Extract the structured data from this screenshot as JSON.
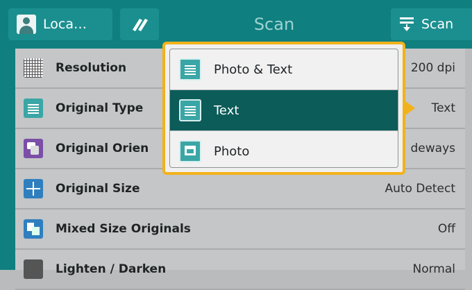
{
  "header": {
    "location_label": "Loca…",
    "title": "Scan",
    "scan_label": "Scan",
    "colors": {
      "bar": "#0f7f7f",
      "button": "#1b8f8f",
      "title": "#9fd2d2"
    }
  },
  "settings": [
    {
      "label": "Resolution",
      "value": "200 dpi",
      "icon": "grid-icon"
    },
    {
      "label": "Original Type",
      "value": "Text",
      "icon": "document-type-icon"
    },
    {
      "label": "Original Orien",
      "value": "deways",
      "icon": "orientation-icon"
    },
    {
      "label": "Original Size",
      "value": "Auto Detect",
      "icon": "size-arrows-icon"
    },
    {
      "label": "Mixed Size Originals",
      "value": "Off",
      "icon": "mixed-size-icon"
    },
    {
      "label": "Lighten / Darken",
      "value": "Normal",
      "icon": "brightness-icon"
    }
  ],
  "popup": {
    "options": [
      {
        "label": "Photo & Text",
        "icon": "photo-text-icon",
        "selected": false
      },
      {
        "label": "Text",
        "icon": "text-icon",
        "selected": true
      },
      {
        "label": "Photo",
        "icon": "photo-icon",
        "selected": false
      }
    ],
    "colors": {
      "border": "#f2b21b",
      "selected_bg": "#0c5c59"
    }
  }
}
